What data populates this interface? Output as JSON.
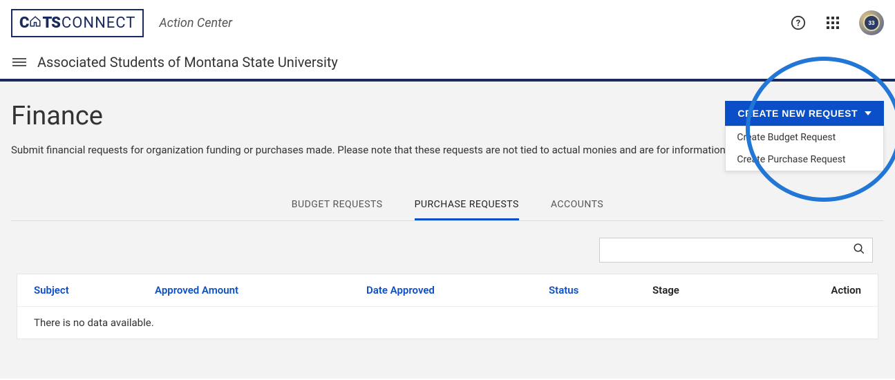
{
  "header": {
    "logo_cats": "C",
    "logo_ts": "TS",
    "logo_connect": "CONNECT",
    "action_center": "Action Center"
  },
  "subheader": {
    "org_name": "Associated Students of Montana State University"
  },
  "page": {
    "title": "Finance",
    "description": "Submit financial requests for organization funding or purchases made. Please note that these requests are not tied to actual monies and are for information only."
  },
  "create": {
    "button": "CREATE NEW REQUEST",
    "items": [
      "Create Budget Request",
      "Create Purchase Request"
    ]
  },
  "tabs": [
    "BUDGET REQUESTS",
    "PURCHASE REQUESTS",
    "ACCOUNTS"
  ],
  "active_tab": 1,
  "table": {
    "columns": [
      "Subject",
      "Approved Amount",
      "Date Approved",
      "Status",
      "Stage",
      "Action"
    ],
    "empty": "There is no data available."
  },
  "search": {
    "value": ""
  }
}
